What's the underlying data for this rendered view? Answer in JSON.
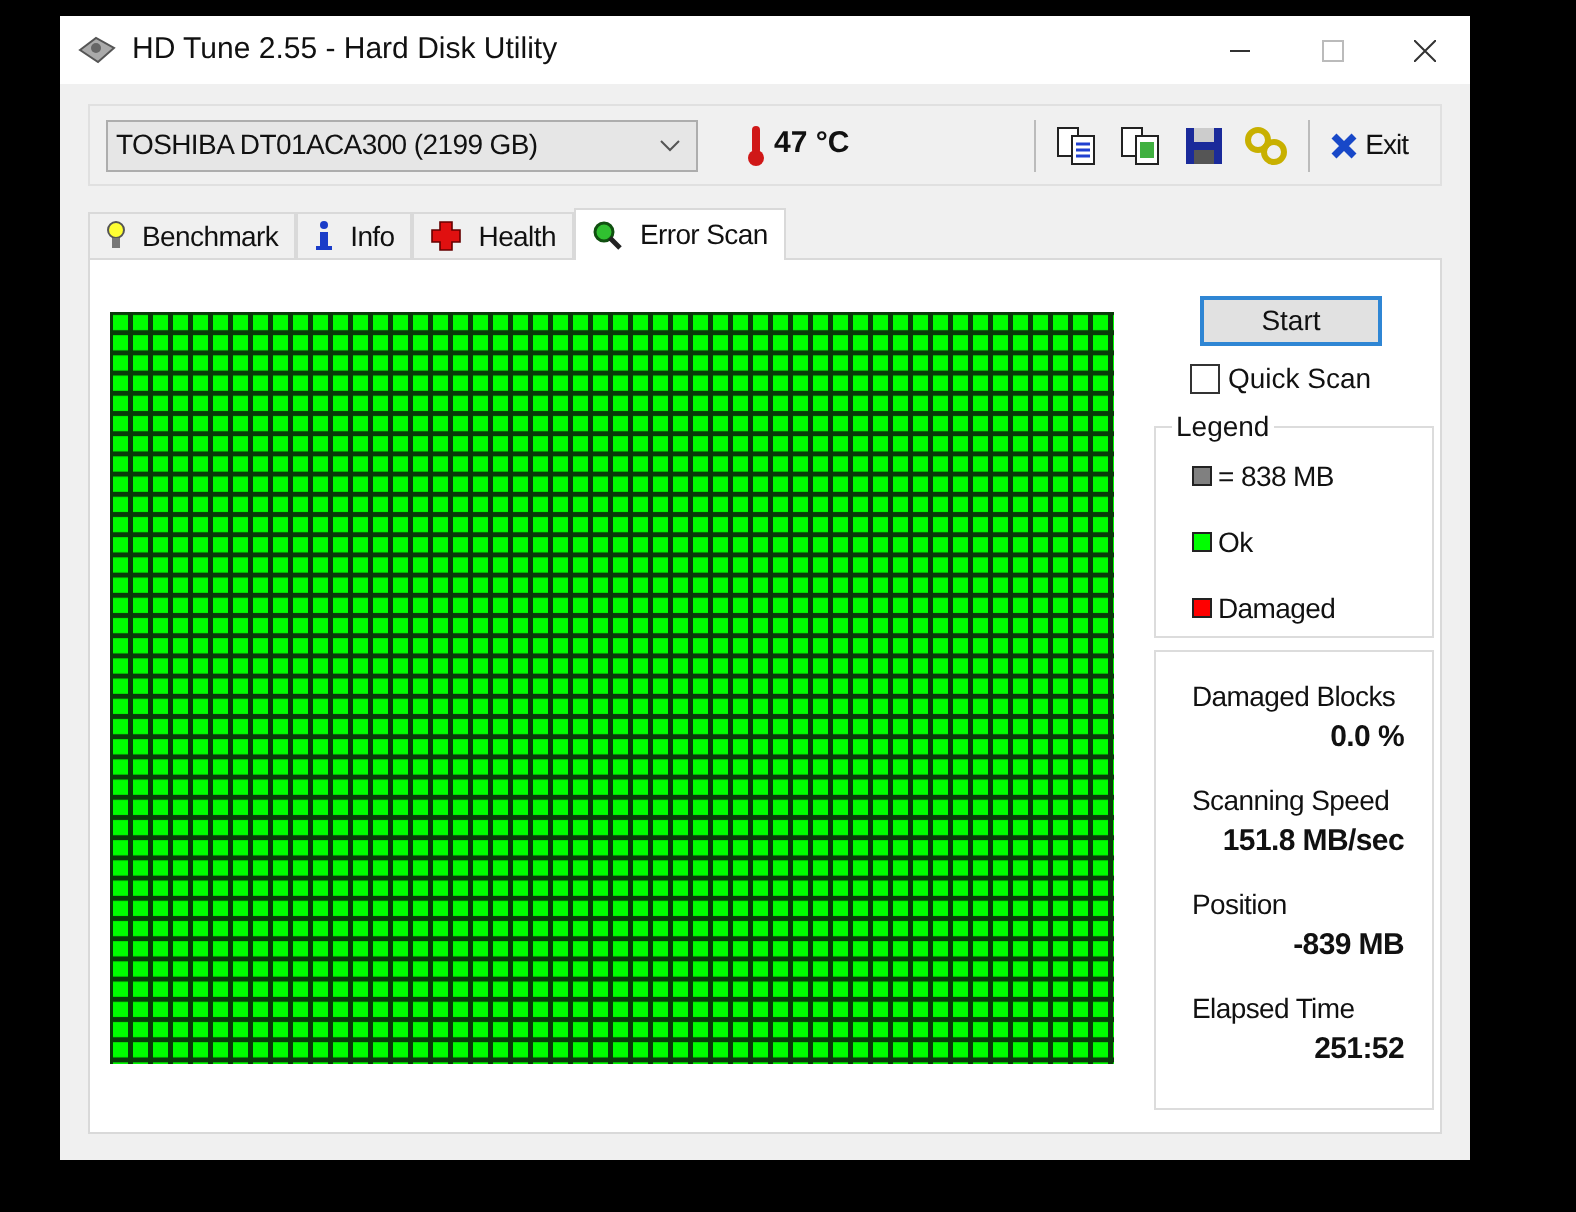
{
  "window": {
    "title": "HD Tune 2.55 - Hard Disk Utility"
  },
  "toolbar": {
    "drive": "TOSHIBA DT01ACA300 (2199 GB)",
    "temperature": "47 °C",
    "exit": "Exit"
  },
  "tabs": [
    {
      "label": "Benchmark",
      "kind": "benchmark",
      "selected": false
    },
    {
      "label": "Info",
      "kind": "info",
      "selected": false
    },
    {
      "label": "Health",
      "kind": "health",
      "selected": false
    },
    {
      "label": "Error Scan",
      "kind": "scan",
      "selected": true
    }
  ],
  "scan_map": {
    "kind": "ok"
  },
  "start_button": "Start",
  "quick_scan": {
    "label": "Quick Scan",
    "checked": false
  },
  "legend": {
    "title": "Legend",
    "items": [
      {
        "label": "= 838 MB",
        "color": "#808080"
      },
      {
        "label": "Ok",
        "color": "#00ff00"
      },
      {
        "label": "Damaged",
        "color": "#ff0000"
      }
    ]
  },
  "stats": [
    {
      "label": "Damaged Blocks",
      "value": "0.0 %"
    },
    {
      "label": "Scanning Speed",
      "value": "151.8 MB/sec"
    },
    {
      "label": "Position",
      "value": "-839 MB"
    },
    {
      "label": "Elapsed Time",
      "value": "251:52"
    }
  ]
}
